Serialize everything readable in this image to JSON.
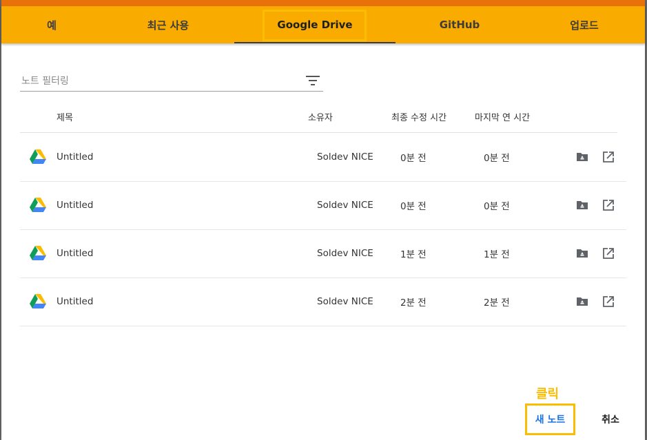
{
  "tabs": [
    {
      "label": "예"
    },
    {
      "label": "최근 사용"
    },
    {
      "label": "Google Drive",
      "selected": true
    },
    {
      "label": "GitHub"
    },
    {
      "label": "업로드"
    }
  ],
  "filter": {
    "placeholder": "노트 필터링",
    "icon": "filter-list-icon"
  },
  "columns": {
    "title": "제목",
    "owner": "소유자",
    "modified": "최종 수정 시간",
    "opened": "마지막 연 시간"
  },
  "rows": [
    {
      "title": "Untitled",
      "owner": "Soldev NICE",
      "modified": "0분 전",
      "opened": "0분 전"
    },
    {
      "title": "Untitled",
      "owner": "Soldev NICE",
      "modified": "0분 전",
      "opened": "0분 전"
    },
    {
      "title": "Untitled",
      "owner": "Soldev NICE",
      "modified": "1분 전",
      "opened": "1분 전"
    },
    {
      "title": "Untitled",
      "owner": "Soldev NICE",
      "modified": "2분 전",
      "opened": "2분 전"
    }
  ],
  "row_icons": {
    "file": "google-drive-icon",
    "folder": "drive-folder-icon",
    "open": "open-in-new-icon"
  },
  "annotation": {
    "text": "클릭"
  },
  "actions": {
    "new_note": "새 노트",
    "cancel": "취소"
  },
  "colors": {
    "tabbar": "#f9ab00",
    "topline": "#e8710a",
    "highlight": "#fbbc04",
    "new_note_text": "#1a73e8"
  }
}
